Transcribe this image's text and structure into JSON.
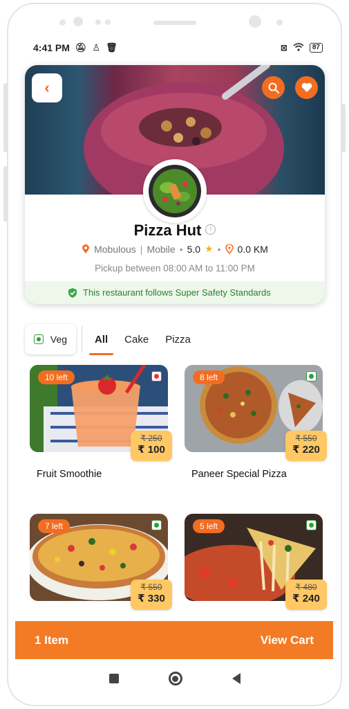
{
  "status_bar": {
    "time": "4:41 PM",
    "battery": "87"
  },
  "restaurant": {
    "name": "Pizza Hut",
    "location": "Mobulous",
    "location_detail": "Mobile",
    "rating": "5.0",
    "distance": "0.0 KM",
    "pickup": "Pickup between 08:00 AM to 11:00 PM",
    "safety": "This restaurant follows Super Safety Standards"
  },
  "filters": {
    "veg_label": "Veg",
    "tabs": [
      {
        "label": "All",
        "active": true
      },
      {
        "label": "Cake",
        "active": false
      },
      {
        "label": "Pizza",
        "active": false
      }
    ]
  },
  "items": [
    {
      "name": "Fruit Smoothie",
      "left": "10 left",
      "old_price": "₹ 250",
      "price": "₹ 100",
      "type": "non-veg",
      "type_color": "#e53935"
    },
    {
      "name": "Paneer Special Pizza",
      "left": "8 left",
      "old_price": "₹ 550",
      "price": "₹ 220",
      "type": "veg",
      "type_color": "#2e9e3e"
    },
    {
      "name": "",
      "left": "7 left",
      "old_price": "₹ 550",
      "price": "₹ 330",
      "type": "veg",
      "type_color": "#2e9e3e"
    },
    {
      "name": "",
      "left": "5 left",
      "old_price": "₹ 480",
      "price": "₹ 240",
      "type": "veg",
      "type_color": "#2e9e3e"
    }
  ],
  "cart": {
    "count_label": "1 Item",
    "action_label": "View Cart"
  },
  "colors": {
    "accent": "#f26d21",
    "price_bg": "#ffc864",
    "safety_bg": "#edf8ea"
  }
}
